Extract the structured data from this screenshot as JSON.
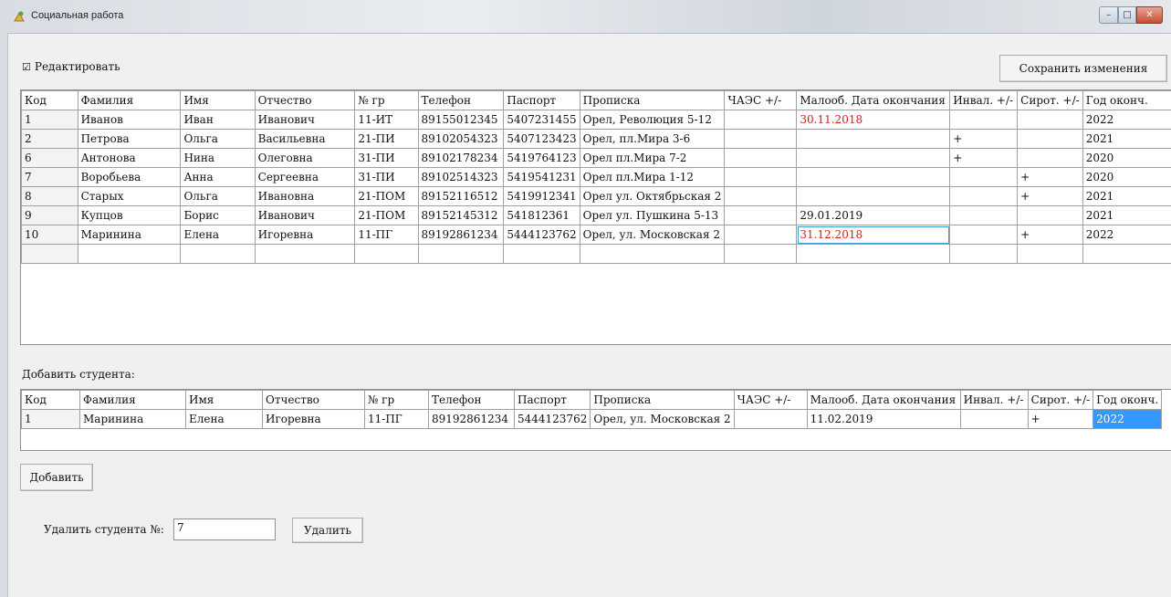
{
  "window": {
    "title": "Социальная работа",
    "min": "–",
    "max": "□",
    "close": "✕"
  },
  "edit_checkbox": {
    "mark": "☑",
    "label": "Редактировать"
  },
  "save_button": "Сохранить изменения",
  "columns": [
    "Код",
    "Фамилия",
    "Имя",
    "Отчество",
    "№ гр",
    "Телефон",
    "Паспорт",
    "Прописка",
    "ЧАЭС +/-",
    "Малооб. Дата окончания",
    "Инвал. +/-",
    "Сирот. +/-",
    "Год оконч."
  ],
  "columns2": [
    "Код",
    "Фамилия",
    "Имя",
    "Отчество",
    "№ гр",
    "Телефон",
    "Паспорт",
    "Прописка",
    "ЧАЭС +/-",
    "Малооб. Дата окончания",
    "Инвал. +/-",
    "Сирот. +/-",
    "Год оконч."
  ],
  "students": [
    [
      "1",
      "Иванов",
      "Иван",
      "Иванович",
      "11-ИТ",
      "89155012345",
      "5407231455",
      "Орел, Революция 5-12",
      "",
      "30.11.2018",
      "",
      "",
      "2022"
    ],
    [
      "2",
      "Петрова",
      "Ольга",
      "Васильевна",
      "21-ПИ",
      "89102054323",
      "5407123423",
      "Орел, пл.Мира 3-6",
      "",
      "",
      "+",
      "",
      "2021"
    ],
    [
      "6",
      "Антонова",
      "Нина",
      "Олеговна",
      "31-ПИ",
      "89102178234",
      "5419764123",
      "Орел пл.Мира 7-2",
      "",
      "",
      "+",
      "",
      "2020"
    ],
    [
      "7",
      "Воробьева",
      "Анна",
      "Сергеевна",
      "31-ПИ",
      "89102514323",
      "5419541231",
      "Орел пл.Мира 1-12",
      "",
      "",
      "",
      "+",
      "2020"
    ],
    [
      "8",
      "Старых",
      "Ольга",
      "Ивановна",
      "21-ПОМ",
      "89152116512",
      "5419912341",
      "Орел ул. Октябрьская 2",
      "",
      "",
      "",
      "+",
      "2021"
    ],
    [
      "9",
      "Купцов",
      "Борис",
      "Иванович",
      "21-ПОМ",
      "89152145312",
      "541812361",
      "Орел ул. Пушкина 5-13",
      "",
      "29.01.2019",
      "",
      "",
      "2021"
    ],
    [
      "10",
      "Маринина",
      "Елена",
      "Игоревна",
      "11-ПГ",
      "89192861234",
      "5444123762",
      "Орел, ул. Московская 2",
      "",
      "31.12.2018",
      "",
      "+",
      "2022"
    ]
  ],
  "add_label": "Добавить студента:",
  "new_student": [
    "1",
    "Маринина",
    "Елена",
    "Игоревна",
    "11-ПГ",
    "89192861234",
    "5444123762",
    "Орел, ул. Московская 2",
    "",
    "11.02.2019",
    "",
    "+",
    "2022"
  ],
  "add_button": "Добавить",
  "delete_label": "Удалить студента №:",
  "delete_value": "7",
  "delete_button": "Удалить",
  "colors": {
    "overdue_date": "#d21d1d",
    "selection": "#3399ff"
  }
}
